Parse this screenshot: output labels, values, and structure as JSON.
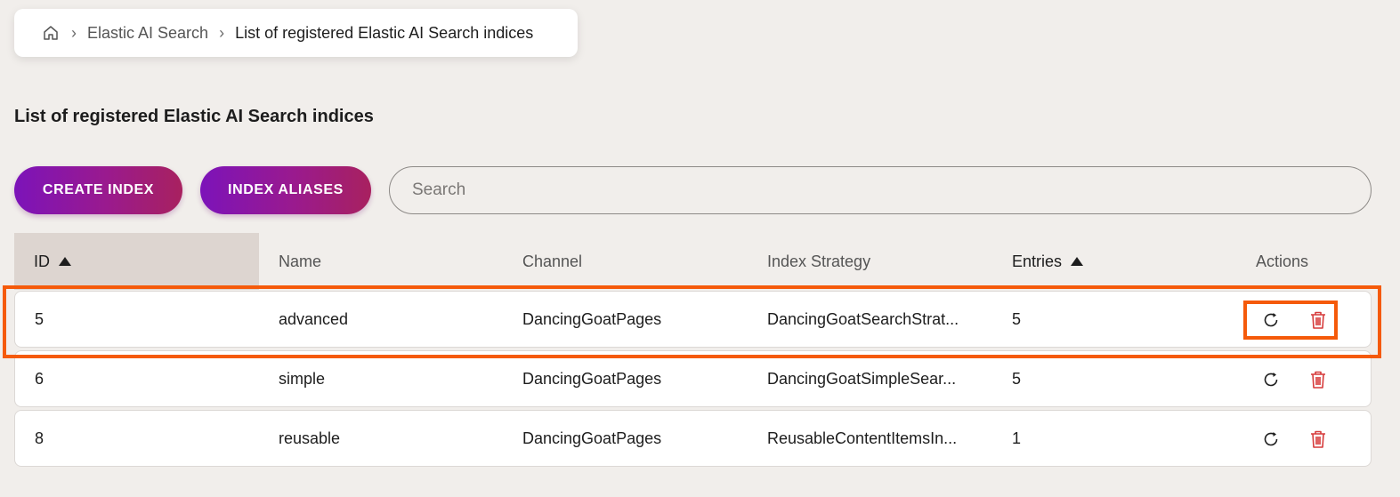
{
  "breadcrumb": {
    "home_icon": "home-icon",
    "items": [
      {
        "label": "Elastic AI Search"
      },
      {
        "label": "List of registered Elastic AI Search indices"
      }
    ]
  },
  "page": {
    "title": "List of registered Elastic AI Search indices"
  },
  "toolbar": {
    "create_label": "CREATE INDEX",
    "aliases_label": "INDEX ALIASES"
  },
  "search": {
    "placeholder": "Search",
    "value": ""
  },
  "table": {
    "columns": [
      {
        "label": "ID",
        "sorted": "ascending"
      },
      {
        "label": "Name"
      },
      {
        "label": "Channel"
      },
      {
        "label": "Index Strategy"
      },
      {
        "label": "Entries",
        "sorted": "ascending"
      },
      {
        "label": "Actions"
      }
    ],
    "rows": [
      {
        "id": "5",
        "name": "advanced",
        "channel": "DancingGoatPages",
        "strategy": "DancingGoatSearchStrat...",
        "entries": "5"
      },
      {
        "id": "6",
        "name": "simple",
        "channel": "DancingGoatPages",
        "strategy": "DancingGoatSimpleSear...",
        "entries": "5"
      },
      {
        "id": "8",
        "name": "reusable",
        "channel": "DancingGoatPages",
        "strategy": "ReusableContentItemsIn...",
        "entries": "1"
      }
    ],
    "action_icons": [
      "rebuild-icon",
      "delete-icon"
    ]
  },
  "colors": {
    "accent_gradient_start": "#7c13b9",
    "accent_gradient_end": "#a8215f",
    "delete": "#d63a3a",
    "highlight": "#f55a0a",
    "background": "#f1eeeb"
  }
}
